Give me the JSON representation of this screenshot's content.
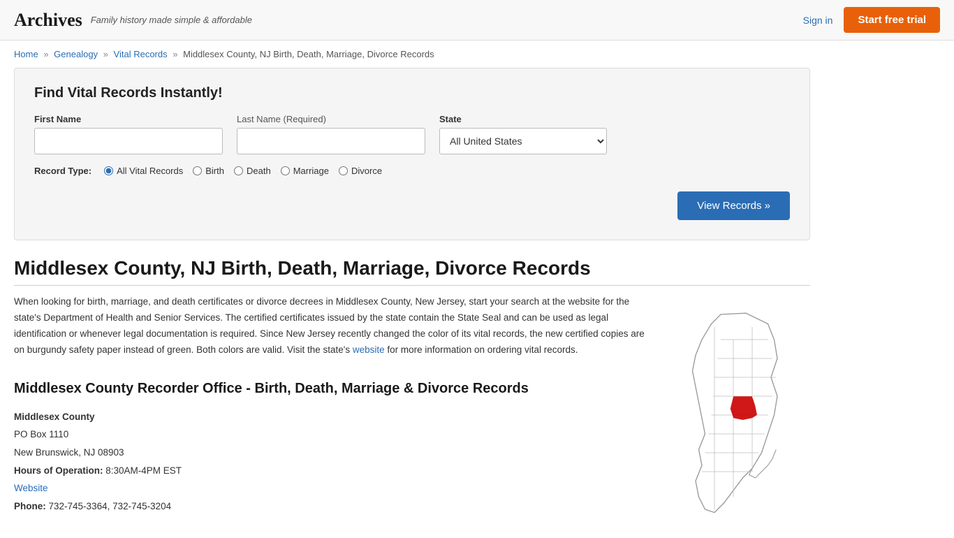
{
  "header": {
    "logo": "Archives",
    "tagline": "Family history made simple & affordable",
    "sign_in": "Sign in",
    "start_trial": "Start free trial"
  },
  "breadcrumb": {
    "home": "Home",
    "genealogy": "Genealogy",
    "vital_records": "Vital Records",
    "current": "Middlesex County, NJ Birth, Death, Marriage, Divorce Records"
  },
  "search": {
    "title": "Find Vital Records Instantly!",
    "first_name_label": "First Name",
    "last_name_label": "Last Name",
    "last_name_required": "(Required)",
    "state_label": "State",
    "state_default": "All United States",
    "record_type_label": "Record Type:",
    "record_types": [
      {
        "label": "All Vital Records",
        "value": "all",
        "checked": true
      },
      {
        "label": "Birth",
        "value": "birth",
        "checked": false
      },
      {
        "label": "Death",
        "value": "death",
        "checked": false
      },
      {
        "label": "Marriage",
        "value": "marriage",
        "checked": false
      },
      {
        "label": "Divorce",
        "value": "divorce",
        "checked": false
      }
    ],
    "view_records_btn": "View Records »"
  },
  "page": {
    "title": "Middlesex County, NJ Birth, Death, Marriage, Divorce Records",
    "body_text": "When looking for birth, marriage, and death certificates or divorce decrees in Middlesex County, New Jersey, start your search at the website for the state's Department of Health and Senior Services. The certified certificates issued by the state contain the State Seal and can be used as legal identification or whenever legal documentation is required. Since New Jersey recently changed the color of its vital records, the new certified copies are on burgundy safety paper instead of green. Both colors are valid. Visit the state's website for more information on ordering vital records.",
    "website_link": "website",
    "section_title": "Middlesex County Recorder Office - Birth, Death, Marriage & Divorce Records",
    "office_name": "Middlesex County",
    "po_box": "PO Box 1110",
    "city_state_zip": "New Brunswick, NJ 08903",
    "hours_label": "Hours of Operation:",
    "hours": "8:30AM-4PM EST",
    "website_text": "Website",
    "phone_label": "Phone:",
    "phone": "732-745-3364, 732-745-3204"
  }
}
